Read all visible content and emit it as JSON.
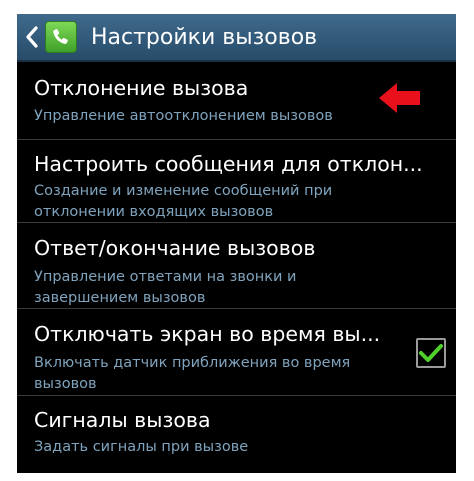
{
  "header": {
    "title": "Настройки вызовов",
    "back_icon": "chevron-left-icon",
    "app_icon": "phone-app-icon"
  },
  "items": [
    {
      "title": "Отклонение вызова",
      "subtitle": "Управление автоотклонением вызовов"
    },
    {
      "title": "Настроить сообщения для отклон...",
      "subtitle": "Создание и изменение сообщений при отклонении входящих вызовов"
    },
    {
      "title": "Ответ/окончание вызовов",
      "subtitle": "Управление ответами на звонки и завершением вызовов"
    },
    {
      "title": "Отключать экран во время вы...",
      "subtitle": "Включать датчик приближения во время вызовов",
      "checked": true
    },
    {
      "title": "Сигналы вызова",
      "subtitle": "Задать сигналы при вызове"
    }
  ],
  "annotation": {
    "icon": "red-arrow-icon",
    "color": "#e8101a"
  }
}
